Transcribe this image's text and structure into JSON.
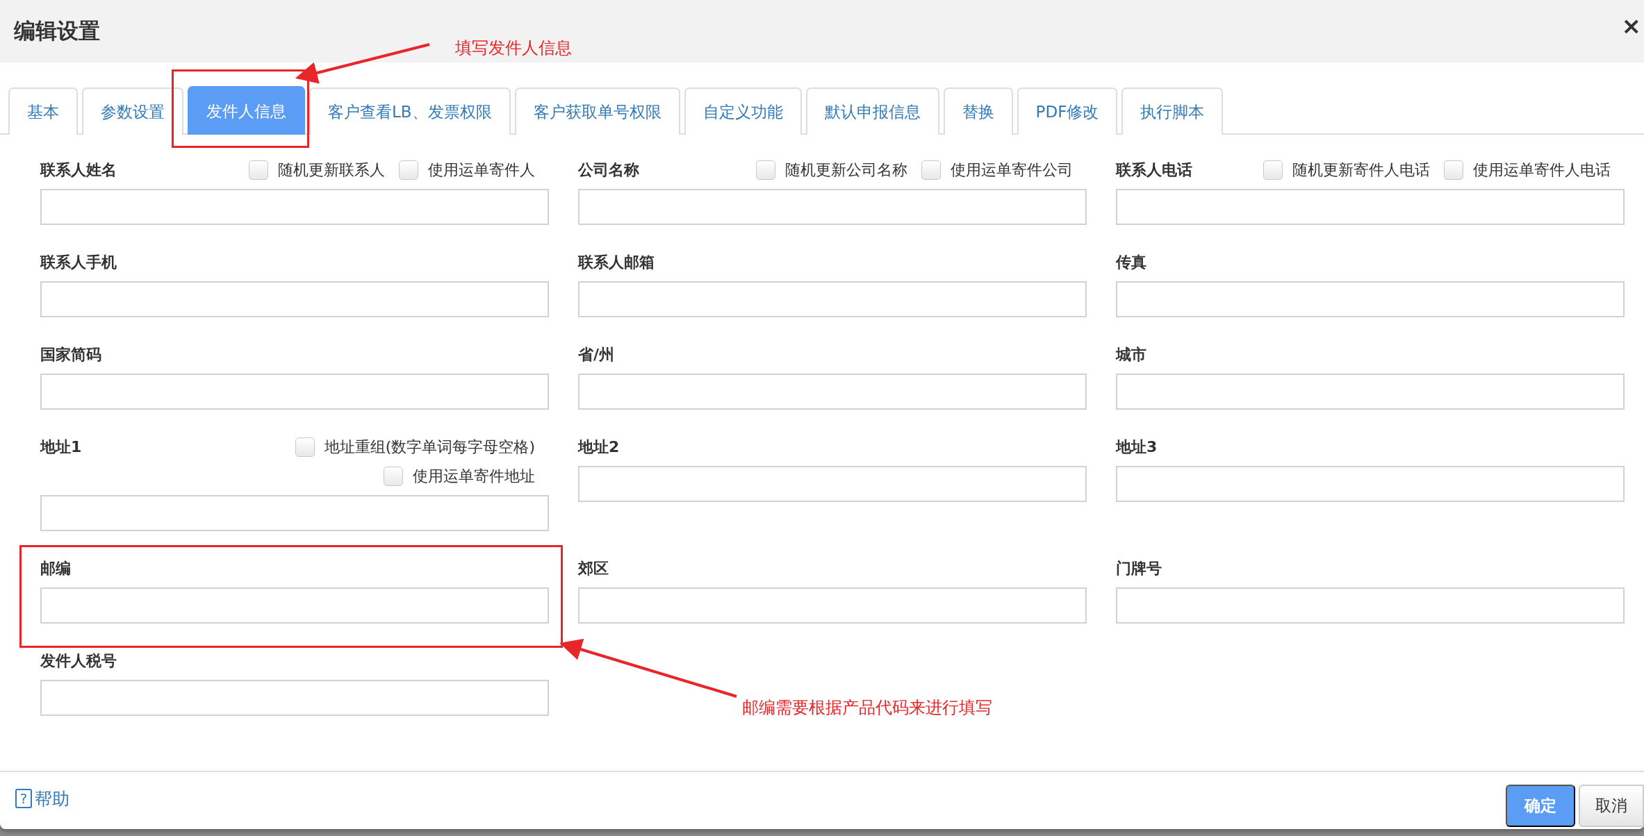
{
  "dialog": {
    "title": "编辑设置",
    "close": "×"
  },
  "tabs": [
    {
      "label": "基本",
      "selected": false
    },
    {
      "label": "参数设置",
      "selected": false
    },
    {
      "label": "发件人信息",
      "selected": true
    },
    {
      "label": "客户查看LB、发票权限",
      "selected": false
    },
    {
      "label": "客户获取单号权限",
      "selected": false
    },
    {
      "label": "自定义功能",
      "selected": false
    },
    {
      "label": "默认申报信息",
      "selected": false
    },
    {
      "label": "替换",
      "selected": false
    },
    {
      "label": "PDF修改",
      "selected": false
    },
    {
      "label": "执行脚本",
      "selected": false
    }
  ],
  "fields": [
    {
      "label": "联系人姓名",
      "kind": "inline",
      "options": [
        {
          "label": "随机更新联系人",
          "checked": false
        },
        {
          "label": "使用运单寄件人",
          "checked": false
        }
      ]
    },
    {
      "label": "公司名称",
      "kind": "inline",
      "options": [
        {
          "label": "随机更新公司名称",
          "checked": false
        },
        {
          "label": "使用运单寄件公司",
          "checked": false
        }
      ]
    },
    {
      "label": "联系人电话",
      "kind": "inline",
      "options": [
        {
          "label": "随机更新寄件人电话",
          "checked": false
        },
        {
          "label": "使用运单寄件人电话",
          "checked": false
        }
      ]
    },
    {
      "label": "联系人手机",
      "kind": "plain"
    },
    {
      "label": "联系人邮箱",
      "kind": "plain"
    },
    {
      "label": "传真",
      "kind": "plain"
    },
    {
      "label": "国家简码",
      "kind": "plain"
    },
    {
      "label": "省/州",
      "kind": "plain"
    },
    {
      "label": "城市",
      "kind": "plain"
    },
    {
      "label": "地址1",
      "kind": "stacked",
      "options": [
        {
          "label": "地址重组(数字单词每字母空格)",
          "checked": false
        },
        {
          "label": "使用运单寄件地址",
          "checked": false
        }
      ]
    },
    {
      "label": "地址2",
      "kind": "plain"
    },
    {
      "label": "地址3",
      "kind": "plain"
    },
    {
      "label": "邮编",
      "kind": "plain"
    },
    {
      "label": "郊区",
      "kind": "plain"
    },
    {
      "label": "门牌号",
      "kind": "plain"
    },
    {
      "label": "发件人税号",
      "kind": "plain"
    }
  ],
  "footer": {
    "help": {
      "icon": "?",
      "label": "帮助"
    },
    "buttons": [
      {
        "label": "确定",
        "kind": "primary"
      },
      {
        "label": "取消",
        "kind": "default"
      }
    ]
  },
  "annotations": [
    {
      "text": "填写发件人信息"
    },
    {
      "text": "邮编需要根据产品代码来进行填写"
    }
  ]
}
